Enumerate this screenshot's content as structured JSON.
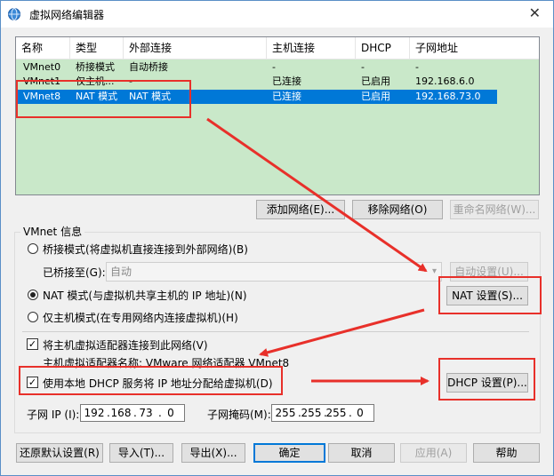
{
  "window": {
    "title": "虚拟网络编辑器",
    "close_glyph": "✕"
  },
  "columns": [
    "名称",
    "类型",
    "外部连接",
    "主机连接",
    "DHCP",
    "子网地址"
  ],
  "networks": [
    {
      "name": "VMnet0",
      "type": "桥接模式",
      "external": "自动桥接",
      "host": "-",
      "dhcp": "-",
      "subnet": "-"
    },
    {
      "name": "VMnet1",
      "type": "仅主机...",
      "external": "-",
      "host": "已连接",
      "dhcp": "已启用",
      "subnet": "192.168.6.0"
    },
    {
      "name": "VMnet8",
      "type": "NAT 模式",
      "external": "NAT 模式",
      "host": "已连接",
      "dhcp": "已启用",
      "subnet": "192.168.73.0"
    }
  ],
  "list_buttons": {
    "add": "添加网络(E)...",
    "remove": "移除网络(O)",
    "rename": "重命名网络(W)..."
  },
  "vmnet_info": {
    "title": "VMnet 信息",
    "bridged": "桥接模式(将虚拟机直接连接到外部网络)(B)",
    "bridged_to_label": "已桥接至(G):",
    "bridged_to_value": "自动",
    "auto_settings": "自动设置(U)...",
    "nat": "NAT 模式(与虚拟机共享主机的 IP 地址)(N)",
    "nat_settings": "NAT 设置(S)...",
    "host_only": "仅主机模式(在专用网络内连接虚拟机)(H)",
    "connect_adapter": "将主机虚拟适配器连接到此网络(V)",
    "adapter_name": "主机虚拟适配器名称: VMware 网络适配器 VMnet8",
    "use_dhcp": "使用本地 DHCP 服务将 IP 地址分配给虚拟机(D)",
    "dhcp_settings": "DHCP 设置(P)...",
    "subnet_ip_label": "子网 IP (I):",
    "subnet_ip": [
      "192",
      "168",
      "73",
      "0"
    ],
    "subnet_mask_label": "子网掩码(M):",
    "subnet_mask": [
      "255",
      "255",
      "255",
      "0"
    ]
  },
  "footer_buttons": {
    "restore": "还原默认设置(R)",
    "import": "导入(T)...",
    "export": "导出(X)...",
    "ok": "确定",
    "cancel": "取消",
    "apply": "应用(A)",
    "help": "帮助"
  },
  "checkmark": "✓",
  "dropdown_glyph": "▾",
  "dot": ".",
  "annotation_color": "#e8302a",
  "selection_color": "#0078d7"
}
